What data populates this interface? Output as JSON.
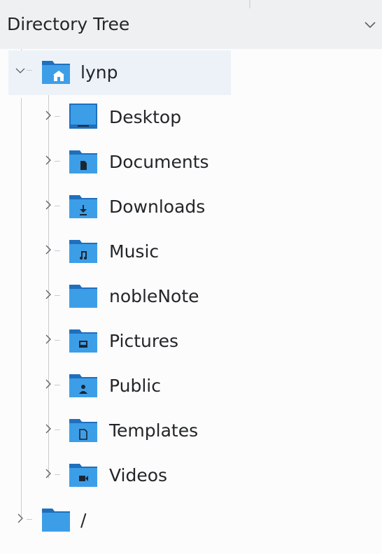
{
  "header": {
    "title": "Directory Tree",
    "chevron_icon": "chevron-down-icon"
  },
  "tree": {
    "root": {
      "label": "lynp",
      "icon": "home-folder-icon",
      "expanded": true,
      "selected": true
    },
    "children": [
      {
        "label": "Desktop",
        "icon": "desktop-folder-icon"
      },
      {
        "label": "Documents",
        "icon": "documents-folder-icon"
      },
      {
        "label": "Downloads",
        "icon": "downloads-folder-icon"
      },
      {
        "label": "Music",
        "icon": "music-folder-icon"
      },
      {
        "label": "nobleNote",
        "icon": "folder-icon"
      },
      {
        "label": "Pictures",
        "icon": "pictures-folder-icon"
      },
      {
        "label": "Public",
        "icon": "public-folder-icon"
      },
      {
        "label": "Templates",
        "icon": "templates-folder-icon"
      },
      {
        "label": "Videos",
        "icon": "videos-folder-icon"
      }
    ],
    "filesystem_root": {
      "label": "/",
      "icon": "folder-icon",
      "expanded": false
    }
  },
  "colors": {
    "folder_blue": "#3d9ee8",
    "folder_dark": "#1f6fbd",
    "folder_tab": "#2a82d4",
    "selection": "#edf2f9",
    "text": "#232629"
  }
}
